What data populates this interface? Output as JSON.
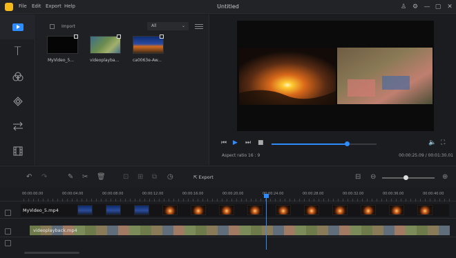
{
  "app": {
    "title": "Untitled"
  },
  "menu": [
    "File",
    "Edit",
    "Export",
    "Help"
  ],
  "window_buttons": [
    "user-icon",
    "settings-icon",
    "minimize-icon",
    "maximize-icon",
    "close-icon"
  ],
  "sidebar": [
    {
      "name": "media",
      "icon": "play-icon"
    },
    {
      "name": "text",
      "icon": "text-icon"
    },
    {
      "name": "filters",
      "icon": "filters-icon"
    },
    {
      "name": "overlays",
      "icon": "layers-icon"
    },
    {
      "name": "transitions",
      "icon": "transition-icon"
    },
    {
      "name": "elements",
      "icon": "film-icon"
    }
  ],
  "media": {
    "import": "Import",
    "filter": "All",
    "clips": [
      {
        "name": "MyVideo_5..."
      },
      {
        "name": "videoplayba..."
      },
      {
        "name": "ca0063e-Aw..."
      }
    ]
  },
  "preview": {
    "aspect_label": "Aspect ratio",
    "aspect_value": "16 : 9",
    "time": "00:00:25.09 / 00:01:30.01",
    "progress": 0.72
  },
  "toolbar": {
    "export": "Export",
    "zoom": 0.45
  },
  "timeline": {
    "ticks": [
      "00:00:00.00",
      "00:00:04.00",
      "00:00:08.00",
      "00:00:12.00",
      "00:00:16.00",
      "00:00:20.00",
      "00:00:24.00",
      "00:00:28.00",
      "00:00:32.00",
      "00:00:36.00",
      "00:00:40.00"
    ],
    "track1_label": "MyVideo_5.mp4",
    "track2_label": "videoplayback.mp4"
  },
  "colors": {
    "accent": "#2f8cff",
    "logo": "#f2b81c"
  }
}
